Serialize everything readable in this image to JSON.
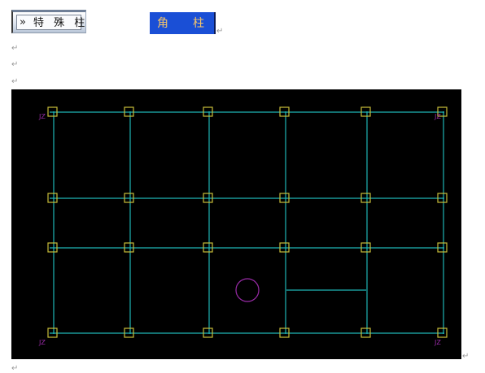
{
  "toolbar": {
    "chevron": "»",
    "special_column_label": "特 殊 柱",
    "corner_column_label": "角柱"
  },
  "para_mark": "↵",
  "drawing": {
    "background": "#000000",
    "grid_color": "#1fb5b5",
    "column_color": "#c8be3a",
    "label_color": "#9a2ba8",
    "circle_color": "#9a2ba8",
    "corner_label": "JZ"
  }
}
